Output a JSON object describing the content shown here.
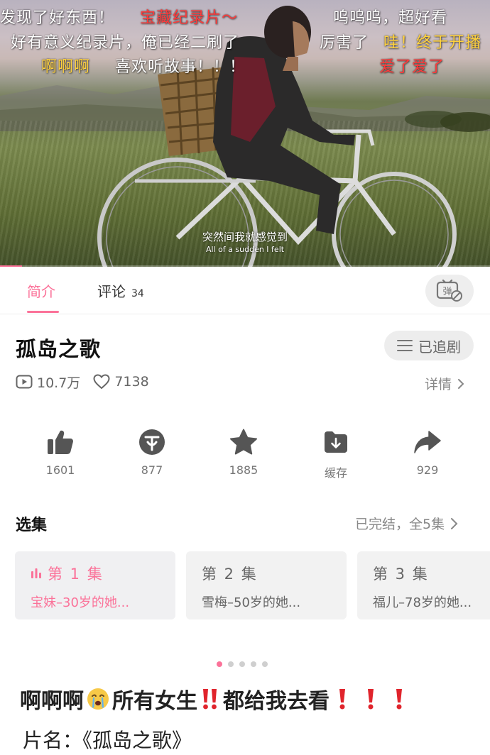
{
  "colors": {
    "accent": "#fb7299",
    "danmaku_white": "#ffffff",
    "danmaku_red": "#ff3b3b",
    "danmaku_yellow": "#ffd23f"
  },
  "video": {
    "danmaku": [
      {
        "text": "发现了好东西！",
        "color": "#ffffff"
      },
      {
        "text": "宝藏纪录片～",
        "color": "#ff3b3b"
      },
      {
        "text": "呜呜呜，超好看",
        "color": "#ffffff"
      },
      {
        "text": "好有意义纪录片，俺已经二刷了",
        "color": "#ffffff"
      },
      {
        "text": "厉害了",
        "color": "#ffffff"
      },
      {
        "text": "哇！终于开播",
        "color": "#ffd23f"
      },
      {
        "text": "啊啊啊",
        "color": "#ffd23f"
      },
      {
        "text": "喜欢听故事！！！",
        "color": "#ffffff"
      },
      {
        "text": "爱了爱了",
        "color": "#ff3b3b"
      }
    ],
    "subtitle_cn": "突然间我就感觉到",
    "subtitle_en": "All of a sudden I felt",
    "progress_fraction": 0.045
  },
  "tabs": [
    {
      "label": "简介",
      "active": true
    },
    {
      "label": "评论",
      "count": "34",
      "active": false
    }
  ],
  "danmaku_toggle": {
    "icon": "danmaku-off-icon",
    "glyph": "弹"
  },
  "show": {
    "title": "孤岛之歌",
    "follow_label": "已追剧",
    "views": "10.7万",
    "likes": "7138",
    "detail_label": "详情"
  },
  "actions": [
    {
      "name": "like",
      "icon": "thumbs-up-icon",
      "label": "1601"
    },
    {
      "name": "coin",
      "icon": "coin-icon",
      "label": "877"
    },
    {
      "name": "favorite",
      "icon": "star-icon",
      "label": "1885"
    },
    {
      "name": "cache",
      "icon": "download-icon",
      "label": "缓存"
    },
    {
      "name": "share",
      "icon": "share-icon",
      "label": "929"
    }
  ],
  "episodes": {
    "title": "选集",
    "meta": "已完结，全5集",
    "items": [
      {
        "num": "第 1 集",
        "sub": "宝妹–30岁的她...",
        "active": true
      },
      {
        "num": "第 2 集",
        "sub": "雪梅–50岁的她...",
        "active": false
      },
      {
        "num": "第 3 集",
        "sub": "福儿–78岁的她...",
        "active": false
      }
    ]
  },
  "carousel": {
    "count": 5,
    "active": 0
  },
  "post": {
    "part1": "啊啊啊",
    "emoji1": "crying-face-icon",
    "part2": "所有女生",
    "emoji2": "double-exclamation-icon",
    "part3": "都给我去看",
    "emoji3": "exclamation-icon",
    "line2": "片名：《孤岛之歌》"
  }
}
